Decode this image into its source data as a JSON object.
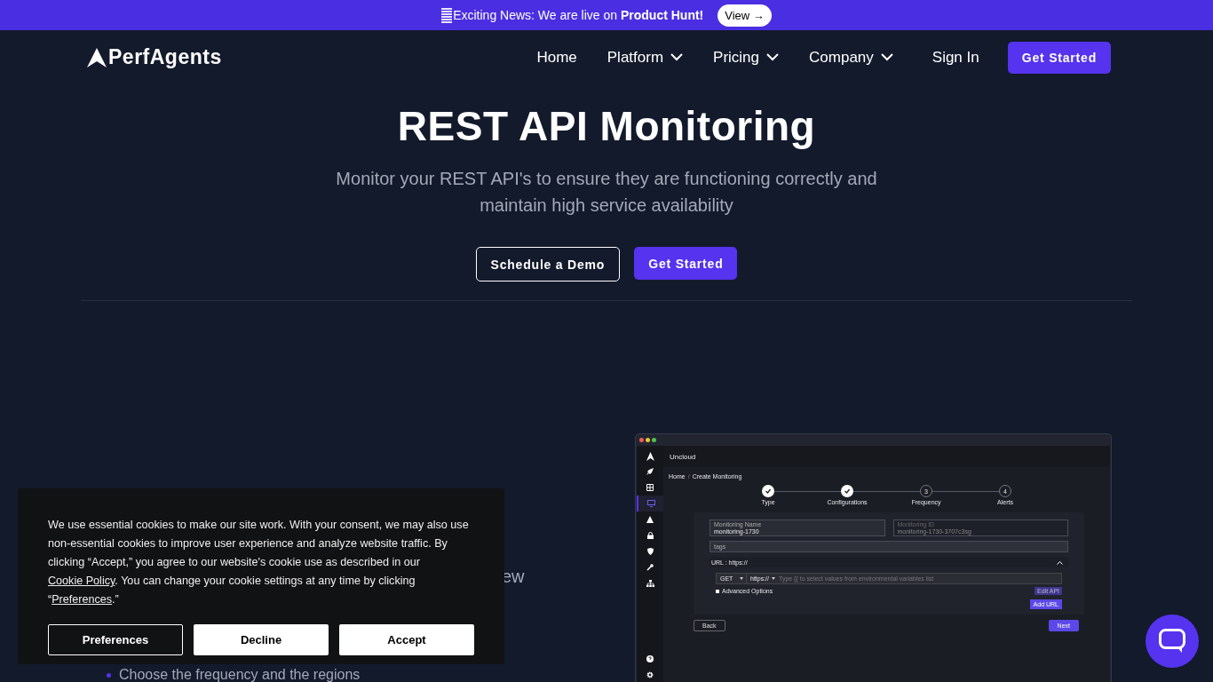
{
  "announcement": {
    "text": "Exciting News: We are live on **Product Hunt!**",
    "button": "View →"
  },
  "nav": {
    "logo": "PerfAgents",
    "items": [
      {
        "label": "Home",
        "has_menu": false
      },
      {
        "label": "Platform",
        "has_menu": true
      },
      {
        "label": "Pricing",
        "has_menu": true
      },
      {
        "label": "Company",
        "has_menu": true
      }
    ],
    "sign_in": "Sign In",
    "cta": "Get Started"
  },
  "hero": {
    "title": "REST API Monitoring",
    "subtitle": "Monitor your REST API's to ensure they are functioning correctly and maintain high service availability",
    "buttons": [
      {
        "label": "Schedule a Demo",
        "kind": "outline"
      },
      {
        "label": "Get Started",
        "kind": "primary"
      }
    ]
  },
  "feature": {
    "text_fragment": "ew",
    "bullets": [
      "Choose the frequency and the regions"
    ]
  },
  "app": {
    "workspace": "Uncloud",
    "sidebar": {
      "items": [
        {
          "selected": false
        },
        {
          "selected": false
        },
        {
          "selected": true
        },
        {
          "selected": false
        },
        {
          "selected": false
        },
        {
          "selected": false
        },
        {
          "selected": false
        },
        {
          "selected": false
        }
      ],
      "bottom_items": [
        {
          "selected": false
        },
        {
          "selected": false
        }
      ]
    },
    "breadcrumb": [
      "Home",
      "Create Monitoring"
    ],
    "breadcrumb_separator": "/",
    "steps": [
      {
        "label": "Type",
        "done": true
      },
      {
        "label": "Configurations",
        "done": true
      },
      {
        "number": "3",
        "label": "Frequency",
        "done": false
      },
      {
        "number": "4",
        "label": "Alerts",
        "done": false
      }
    ],
    "fields": {
      "name_label": "Monitoring Name",
      "name_value": "monitoring-1730",
      "id_label": "Monitoring ID",
      "id_value": "monitoring-1730-3707c3sg",
      "tags_placeholder": "tags"
    },
    "url_section": {
      "title": "URL : https://",
      "expanded": true,
      "method": "GET",
      "protocol": "https://",
      "url_placeholder": "Type {{ to select values from environmental variables list",
      "advanced_label": "Advanced Options",
      "advanced_checked": false,
      "edit_button": "Edit API",
      "add_button": "Add URL"
    },
    "back": "Back",
    "next": "Next"
  },
  "cookie": {
    "text_before": "We use essential cookies to make our site work. With your consent, we may also use non-essential cookies to improve user experience and analyze website traffic. By clicking “Accept,” you agree to our website's cookie use as described in our ",
    "link_policy": "Cookie Policy",
    "text_middle": ". You can change your cookie settings at any time by clicking “",
    "link_prefs": "Preferences",
    "text_after": ".”",
    "buttons": [
      {
        "label": "Preferences",
        "kind": "outline"
      },
      {
        "label": "Decline",
        "kind": "solid"
      },
      {
        "label": "Accept",
        "kind": "solid"
      }
    ]
  }
}
